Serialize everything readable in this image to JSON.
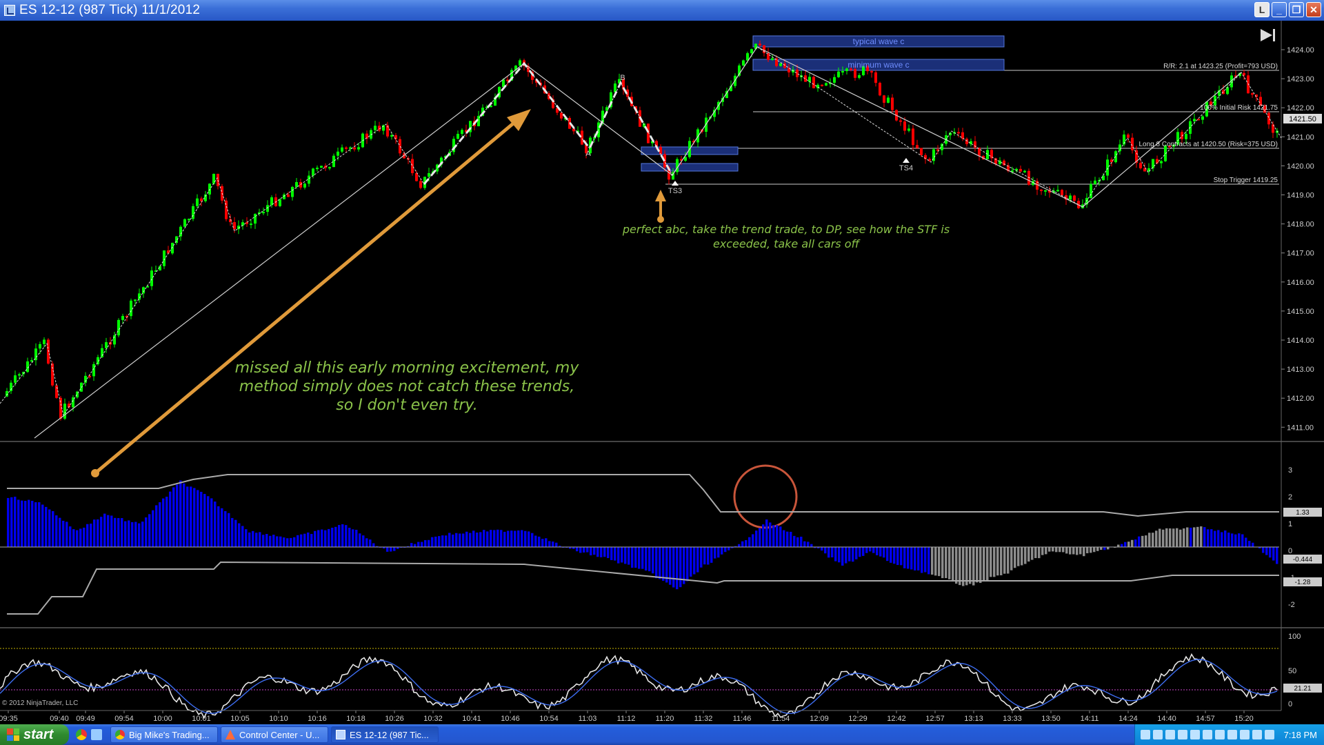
{
  "window": {
    "title": "ES 12-12 (987 Tick)  11/1/2012",
    "buttons": {
      "help": "L",
      "minimize": "_",
      "restore": "❐",
      "close": "✕"
    }
  },
  "chart": {
    "price_axis": [
      "1424.00",
      "1423.00",
      "1422.00",
      "1421.00",
      "1420.00",
      "1419.00",
      "1418.00",
      "1417.00",
      "1416.00",
      "1415.00",
      "1414.00",
      "1413.00",
      "1412.00",
      "1411.00"
    ],
    "last_price": "1421.50",
    "osc_axis": [
      "3",
      "2",
      "1",
      "0",
      "-1",
      "-2"
    ],
    "osc_labels": {
      "upper": "1.33",
      "current": "-0.444",
      "lower": "-1.28"
    },
    "stoch_axis": [
      "100",
      "50",
      "0"
    ],
    "stoch_value": "21.21",
    "time_axis": [
      "09:35",
      "09:40",
      "09:49",
      "09:54",
      "10:00",
      "10:01",
      "10:05",
      "10:10",
      "10:16",
      "10:18",
      "10:26",
      "10:32",
      "10:41",
      "10:46",
      "10:54",
      "11:03",
      "11:12",
      "11:20",
      "11:32",
      "11:46",
      "11:54",
      "12:09",
      "12:29",
      "12:42",
      "12:57",
      "13:13",
      "13:33",
      "13:50",
      "14:11",
      "14:24",
      "14:40",
      "14:57",
      "15:20"
    ],
    "copyright": "© 2012 NinjaTrader, LLC",
    "labels": {
      "typical_wave": "typical wave c",
      "minimum_wave": "minimum wave c",
      "rr": "R/R: 2.1 at 1423.25 (Profit=793 USD)",
      "initial_risk": "100% Initial Risk 1421.75",
      "long_entry": "Long 8 Contracts at 1420.50 (Risk=375 USD)",
      "stop": "Stop Trigger 1419.25",
      "a": "A",
      "b": "B",
      "ts3": "TS3",
      "ts4": "TS4"
    },
    "colors": {
      "up": "#00ff00",
      "down": "#ff0000",
      "hist": "#0000ee",
      "hist_gray": "#8c8c8c",
      "annotation": "#8bc34a",
      "arrow": "#e09a3a"
    }
  },
  "notes": {
    "left": [
      "missed all this early morning excitement, my",
      "method simply does not catch these trends,",
      "so I don't even try."
    ],
    "right": [
      "perfect abc, take the trend trade, to DP, see how the STF is",
      "exceeded, take all cars off"
    ]
  },
  "taskbar": {
    "start": "start",
    "tasks": [
      "Big Mike's Trading...",
      "Control Center - U...",
      "ES 12-12 (987 Tic..."
    ],
    "clock": "7:18 PM"
  }
}
